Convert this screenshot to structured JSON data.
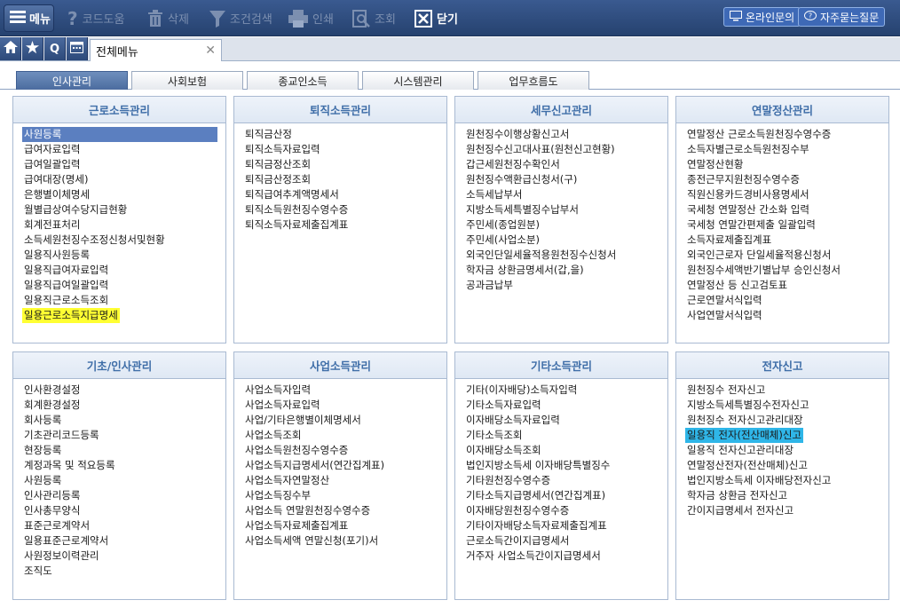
{
  "toolbar": {
    "menu_label": "메뉴",
    "code_help": "코드도움",
    "delete": "삭제",
    "filter_search": "조건검색",
    "print": "인쇄",
    "view": "조회",
    "close": "닫기",
    "online_inquiry": "온라인문의",
    "faq": "자주묻는질문"
  },
  "tabbar": {
    "quick_q": "Q",
    "page_tab": "전체메뉴"
  },
  "section_tabs": [
    "인사관리",
    "사회보험",
    "종교인소득",
    "시스템관리",
    "업무흐름도"
  ],
  "panels": [
    {
      "title": "근로소득관리",
      "items": [
        "사원등록",
        "급여자료입력",
        "급여일괄입력",
        "급여대장(명세)",
        "은행별이체명세",
        "월별급상여수당지급현황",
        "회계전표처리",
        "소득세원천징수조정신청서및현황",
        "일용직사원등록",
        "일용직급여자료입력",
        "일용직급여일괄입력",
        "일용직근로소득조회",
        "일용근로소득지급명세"
      ]
    },
    {
      "title": "퇴직소득관리",
      "items": [
        "퇴직금산정",
        "퇴직소득자료입력",
        "퇴직금정산조회",
        "퇴직금산정조회",
        "퇴직급여추계액명세서",
        "퇴직소득원천징수영수증",
        "퇴직소득자료제출집계표"
      ]
    },
    {
      "title": "세무신고관리",
      "items": [
        "원천징수이행상황신고서",
        "원천징수신고대사표(원천신고현황)",
        "갑근세원천징수확인서",
        "원천징수액환급신청서(구)",
        "소득세납부서",
        "지방소득세특별징수납부서",
        "주민세(종업원분)",
        "주민세(사업소분)",
        "외국인단일세율적용원천징수신청서",
        "학자금 상환금명세서(갑,을)",
        "공과금납부"
      ]
    },
    {
      "title": "연말정산관리",
      "items": [
        "연말정산 근로소득원천징수영수증",
        "소득자별근로소득원천징수부",
        "연말정산현황",
        "종전근무지원천징수영수증",
        "직원신용카드경비사용명세서",
        "국세청 연말정산 간소화 입력",
        "국세청 연말간편제출 일괄입력",
        "소득자료제출집계표",
        "외국인근로자 단일세율적용신청서",
        "원천징수세액반기별납부 승인신청서",
        "연말정산 등 신고검토표",
        "근로연말서식입력",
        "사업연말서식입력"
      ]
    },
    {
      "title": "기초/인사관리",
      "items": [
        "인사환경설정",
        "회계환경설정",
        "회사등록",
        "기초관리코드등록",
        "현장등록",
        "계정과목 및 적요등록",
        "사원등록",
        "인사관리등록",
        "인사총무양식",
        "표준근로계약서",
        "일용표준근로계약서",
        "사원정보이력관리",
        "조직도"
      ]
    },
    {
      "title": "사업소득관리",
      "items": [
        "사업소득자입력",
        "사업소득자료입력",
        "사업/기타은행별이체명세서",
        "사업소득조회",
        "사업소득원천징수영수증",
        "사업소득지급명세서(연간집계표)",
        "사업소득자연말정산",
        "사업소득징수부",
        "사업소득 연말원천징수영수증",
        "사업소득자료제출집계표",
        "사업소득세액 연말신청(포기)서"
      ]
    },
    {
      "title": "기타소득관리",
      "items": [
        "기타(이자배당)소득자입력",
        "기타소득자료입력",
        "이자배당소득자료입력",
        "기타소득조회",
        "이자배당소득조회",
        "법인지방소득세 이자배당특별징수",
        "기타원천징수영수증",
        "기타소득지급명세서(연간집계표)",
        "이자배당원천징수영수증",
        "기타이자배당소득자료제출집계표",
        "근로소득간이지급명세서",
        "거주자 사업소득간이지급명세서"
      ]
    },
    {
      "title": "전자신고",
      "items": [
        "원천징수 전자신고",
        "지방소득세특별징수전자신고",
        "원천징수 전자신고관리대장",
        "일용직 전자(전산매체)신고",
        "일용직 전자신고관리대장",
        "연말정산전자(전산매체)신고",
        "법인지방소득세 이자배당전자신고",
        "학자금 상환금 전자신고",
        "간이지급명세서 전자신고"
      ]
    }
  ],
  "colors": {
    "toolbar_bg": "#2f4c7e",
    "section_header_text": "#3f6ea8",
    "selected_item": "#5b7fc0",
    "highlight_yellow": "#ffff33",
    "highlight_cyan": "#2fb6e8"
  }
}
